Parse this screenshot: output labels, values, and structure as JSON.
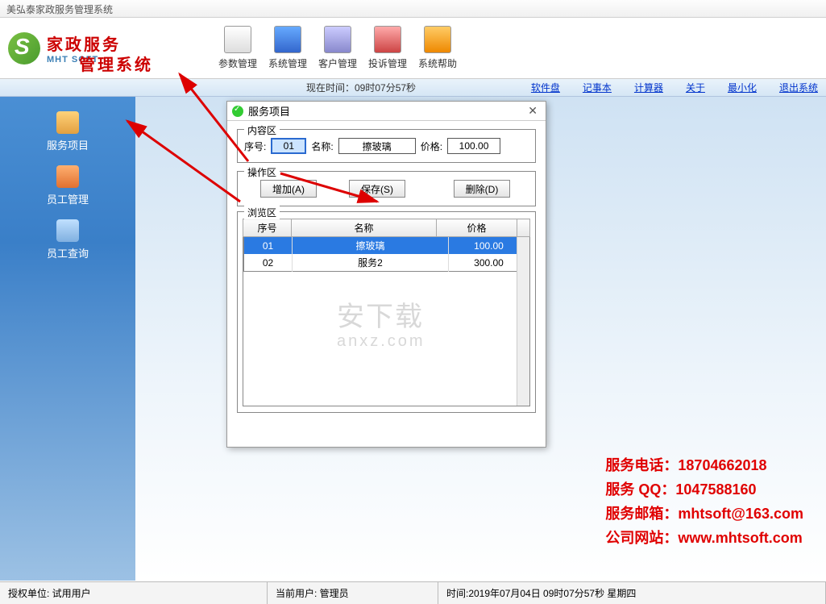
{
  "window_title": "美弘泰家政服务管理系统",
  "logo": {
    "line1": "家政服务",
    "line2": "管理系统",
    "en": "MHT SOFT"
  },
  "toolbar": [
    {
      "label": "参数管理"
    },
    {
      "label": "系统管理"
    },
    {
      "label": "客户管理"
    },
    {
      "label": "投诉管理"
    },
    {
      "label": "系统帮助"
    }
  ],
  "time_label": "现在时间：09时07分57秒",
  "links": [
    "软件盘",
    "记事本",
    "计算器",
    "关于",
    "最小化",
    "退出系统"
  ],
  "sidebar": [
    {
      "label": "服务项目"
    },
    {
      "label": "员工管理"
    },
    {
      "label": "员工查询"
    }
  ],
  "dialog": {
    "title": "服务项目",
    "content_legend": "内容区",
    "xu_label": "序号:",
    "xu_value": "01",
    "name_label": "名称:",
    "name_value": "擦玻璃",
    "price_label": "价格:",
    "price_value": "100.00",
    "ops_legend": "操作区",
    "btn_add": "增加(A)",
    "btn_save": "保存(S)",
    "btn_del": "删除(D)",
    "browse_legend": "浏览区",
    "cols": [
      "序号",
      "名称",
      "价格"
    ],
    "rows": [
      {
        "xu": "01",
        "name": "擦玻璃",
        "price": "100.00",
        "sel": true
      },
      {
        "xu": "02",
        "name": "服务2",
        "price": "300.00",
        "sel": false
      }
    ]
  },
  "watermark": {
    "cn": "安下载",
    "url": "anxz.com"
  },
  "contact": {
    "phone": "服务电话：18704662018",
    "qq": "服务 QQ：1047588160",
    "mail": "服务邮箱：mhtsoft@163.com",
    "site": "公司网站：www.mhtsoft.com"
  },
  "status": {
    "auth": "授权单位: 试用用户",
    "user": "当前用户: 管理员",
    "time": "时间:2019年07月04日 09时07分57秒 星期四"
  }
}
